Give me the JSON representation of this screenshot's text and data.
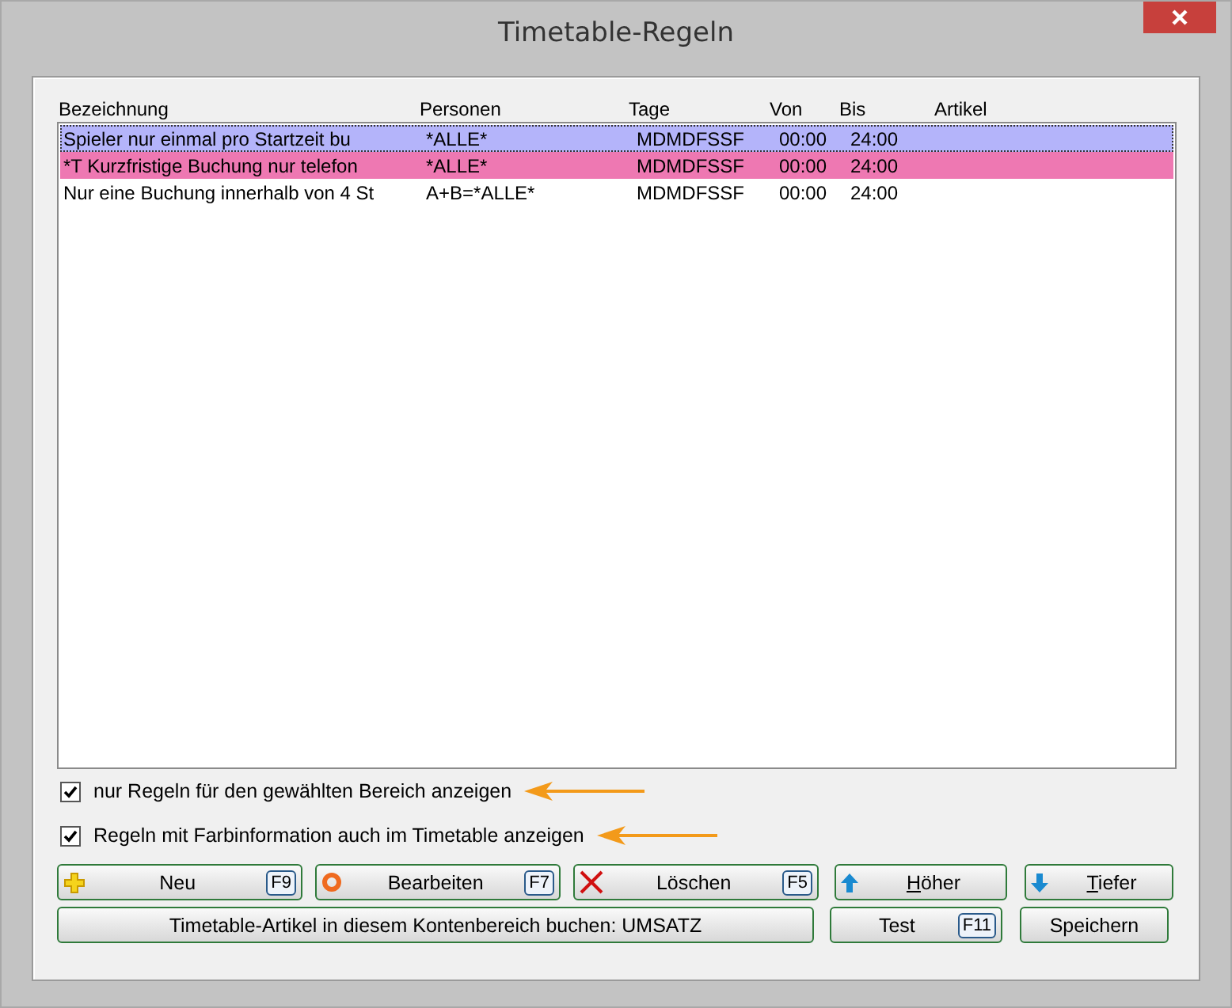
{
  "window": {
    "title": "Timetable-Regeln"
  },
  "table": {
    "columns": [
      "Bezeichnung",
      "Personen",
      "Tage",
      "Von",
      "Bis",
      "Artikel"
    ],
    "rows": [
      {
        "cells": [
          "Spieler nur einmal pro Startzeit bu",
          "*ALLE*",
          "MDMDFSSF",
          "00:00",
          "24:00"
        ],
        "selected": true,
        "color": "#b4b4fa"
      },
      {
        "cells": [
          "*T Kurzfristige Buchung nur telefon",
          "*ALLE*",
          "MDMDFSSF",
          "00:00",
          "24:00"
        ],
        "selected": false,
        "color": "#ee78b2"
      },
      {
        "cells": [
          "Nur eine Buchung innerhalb von 4 St",
          "A+B=*ALLE*",
          "MDMDFSSF",
          "00:00",
          "24:00"
        ],
        "selected": false,
        "color": "#ffffff"
      }
    ]
  },
  "options": [
    {
      "label": "nur Regeln für den gewählten Bereich anzeigen",
      "checked": true,
      "highlighted": true
    },
    {
      "label": "Regeln mit Farbinformation auch im Timetable anzeigen",
      "checked": true,
      "highlighted": true
    }
  ],
  "button_rows": [
    [
      {
        "label": "Neu",
        "kind": "add",
        "hotkey": "F9",
        "underline_first": false
      },
      {
        "label": "Bearbeiten",
        "kind": "edit",
        "hotkey": "F7",
        "underline_first": false
      },
      {
        "label": "Löschen",
        "kind": "delete",
        "hotkey": "F5",
        "underline_first": false
      },
      {
        "label": "Höher",
        "kind": "up",
        "underline_first": true
      },
      {
        "label": "Tiefer",
        "kind": "down",
        "underline_first": true
      }
    ],
    [
      {
        "label": "Timetable-Artikel in diesem Kontenbereich buchen: UMSATZ",
        "kind": "plain",
        "underline_first": false
      },
      {
        "label": "Test",
        "kind": "plain",
        "hotkey": "F11",
        "underline_first": false
      },
      {
        "label": "Speichern",
        "kind": "plain",
        "underline_first": false
      }
    ]
  ]
}
